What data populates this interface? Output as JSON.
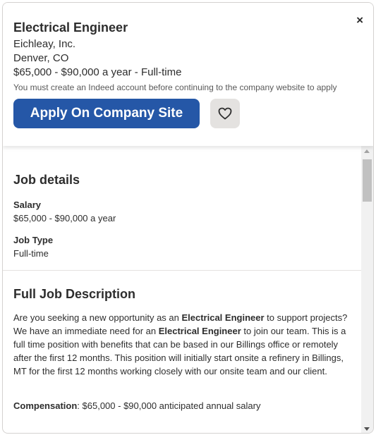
{
  "header": {
    "job_title": "Electrical Engineer",
    "company": "Eichleay, Inc.",
    "location": "Denver, CO",
    "salary_type": "$65,000 - $90,000 a year  - Full-time",
    "notice": "You must create an Indeed account before continuing to the company website to apply",
    "apply_label": "Apply On Company Site",
    "close_glyph": "×"
  },
  "job_details": {
    "heading": "Job details",
    "salary_label": "Salary",
    "salary_value": "$65,000 - $90,000 a year",
    "type_label": "Job Type",
    "type_value": "Full-time"
  },
  "description": {
    "heading": "Full Job Description",
    "p1_a": "Are you seeking a new opportunity as an ",
    "p1_b": "Electrical Engineer",
    "p1_c": " to support projects? We have an immediate need for an ",
    "p1_d": "Electrical Engineer",
    "p1_e": " to join our team. This is a full time position with benefits that can be based in our Billings office or remotely after the first 12 months. This position will initially start onsite a refinery in Billings, MT for the first 12 months working closely with our onsite team and our client.",
    "comp_label": "Compensation",
    "comp_value": ": $65,000 - $90,000 anticipated annual salary"
  },
  "colors": {
    "apply_button": "#2557a7",
    "heart_button": "#e4e2e0",
    "text": "#2d2d2d"
  },
  "icons": {
    "close": "close-icon",
    "save": "heart-icon",
    "scroll_up": "chevron-up-icon",
    "scroll_down": "chevron-down-icon"
  }
}
